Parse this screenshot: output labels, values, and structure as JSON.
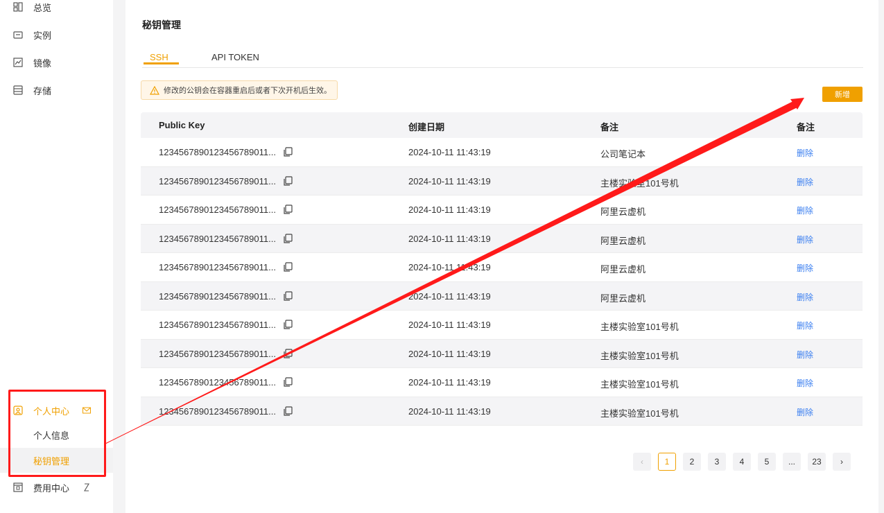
{
  "sidebar": {
    "items": [
      {
        "label": "总览",
        "icon": "dashboard-icon"
      },
      {
        "label": "实例",
        "icon": "instance-icon"
      },
      {
        "label": "镜像",
        "icon": "image-icon"
      },
      {
        "label": "存储",
        "icon": "storage-icon"
      }
    ],
    "personal_center": {
      "label": "个人中心",
      "icon": "user-center-icon",
      "badge_icon": "mail-icon"
    },
    "sub_items": [
      {
        "label": "个人信息"
      },
      {
        "label": "秘钥管理"
      }
    ],
    "billing": {
      "label": "费用中心",
      "icon": "billing-icon",
      "extra_icon": "hourglass-icon"
    }
  },
  "main": {
    "title": "秘钥管理",
    "tabs": [
      {
        "label": "SSH"
      },
      {
        "label": "API TOKEN"
      }
    ],
    "alert": "修改的公钥会在容器重启后或者下次开机后生效。",
    "add_button": "新增",
    "table": {
      "headers": [
        "Public Key",
        "创建日期",
        "备注",
        "备注"
      ],
      "rows": [
        {
          "key": "1234567890123456789011...",
          "date": "2024-10-11 11:43:19",
          "note": "公司笔记本",
          "action": "删除"
        },
        {
          "key": "1234567890123456789011...",
          "date": "2024-10-11 11:43:19",
          "note": "主楼实验室101号机",
          "action": "删除"
        },
        {
          "key": "1234567890123456789011...",
          "date": "2024-10-11 11:43:19",
          "note": "阿里云虚机",
          "action": "删除"
        },
        {
          "key": "1234567890123456789011...",
          "date": "2024-10-11 11:43:19",
          "note": "阿里云虚机",
          "action": "删除"
        },
        {
          "key": "1234567890123456789011...",
          "date": "2024-10-11 11:43:19",
          "note": "阿里云虚机",
          "action": "删除"
        },
        {
          "key": "1234567890123456789011...",
          "date": "2024-10-11 11:43:19",
          "note": "阿里云虚机",
          "action": "删除"
        },
        {
          "key": "1234567890123456789011...",
          "date": "2024-10-11 11:43:19",
          "note": "主楼实验室101号机",
          "action": "删除"
        },
        {
          "key": "1234567890123456789011...",
          "date": "2024-10-11 11:43:19",
          "note": "主楼实验室101号机",
          "action": "删除"
        },
        {
          "key": "1234567890123456789011...",
          "date": "2024-10-11 11:43:19",
          "note": "主楼实验室101号机",
          "action": "删除"
        },
        {
          "key": "1234567890123456789011...",
          "date": "2024-10-11 11:43:19",
          "note": "主楼实验室101号机",
          "action": "删除"
        }
      ]
    },
    "pagination": {
      "prev": "‹",
      "pages": [
        "1",
        "2",
        "3",
        "4",
        "5",
        "...",
        "23"
      ],
      "next": "›",
      "current": "1"
    }
  },
  "colors": {
    "accent": "#f0a000",
    "link": "#3b7ff0",
    "annotation": "#ff1a1a"
  }
}
